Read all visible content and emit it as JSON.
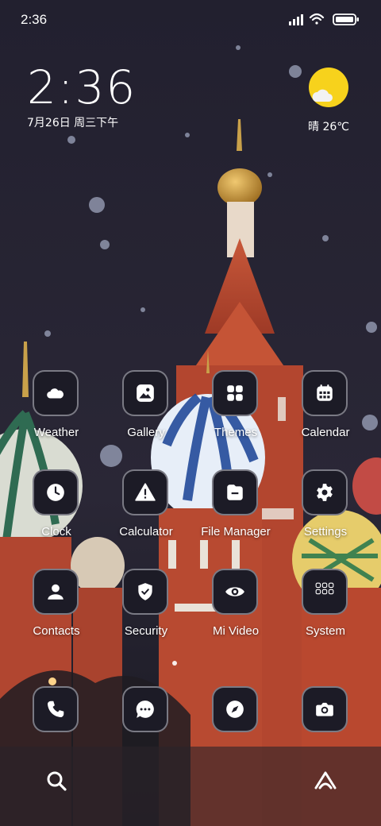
{
  "status_bar": {
    "time": "2:36"
  },
  "clock_widget": {
    "time": "2:36",
    "date": "7月26日 周三下午"
  },
  "weather_widget": {
    "text": "晴 26℃",
    "icon": "sunny-cloud-icon"
  },
  "apps": [
    {
      "label": "Weather",
      "icon": "cloud-icon"
    },
    {
      "label": "Gallery",
      "icon": "gallery-icon"
    },
    {
      "label": "Themes",
      "icon": "themes-grid-icon"
    },
    {
      "label": "Calendar",
      "icon": "calendar-icon"
    },
    {
      "label": "Clock",
      "icon": "clock-icon"
    },
    {
      "label": "Calculator",
      "icon": "warning-icon"
    },
    {
      "label": "File Manager",
      "icon": "folder-icon"
    },
    {
      "label": "Settings",
      "icon": "gear-icon"
    },
    {
      "label": "Contacts",
      "icon": "person-icon"
    },
    {
      "label": "Security",
      "icon": "shield-icon"
    },
    {
      "label": "Mi Video",
      "icon": "eye-icon"
    },
    {
      "label": "System",
      "icon": "folder-grid-icon"
    }
  ],
  "dock": [
    {
      "icon": "phone-icon"
    },
    {
      "icon": "message-icon"
    },
    {
      "icon": "compass-icon"
    },
    {
      "icon": "camera-icon"
    }
  ],
  "colors": {
    "tile_bg": "#1c1b26",
    "sun": "#f7d21c",
    "sky": "#201e2d"
  }
}
